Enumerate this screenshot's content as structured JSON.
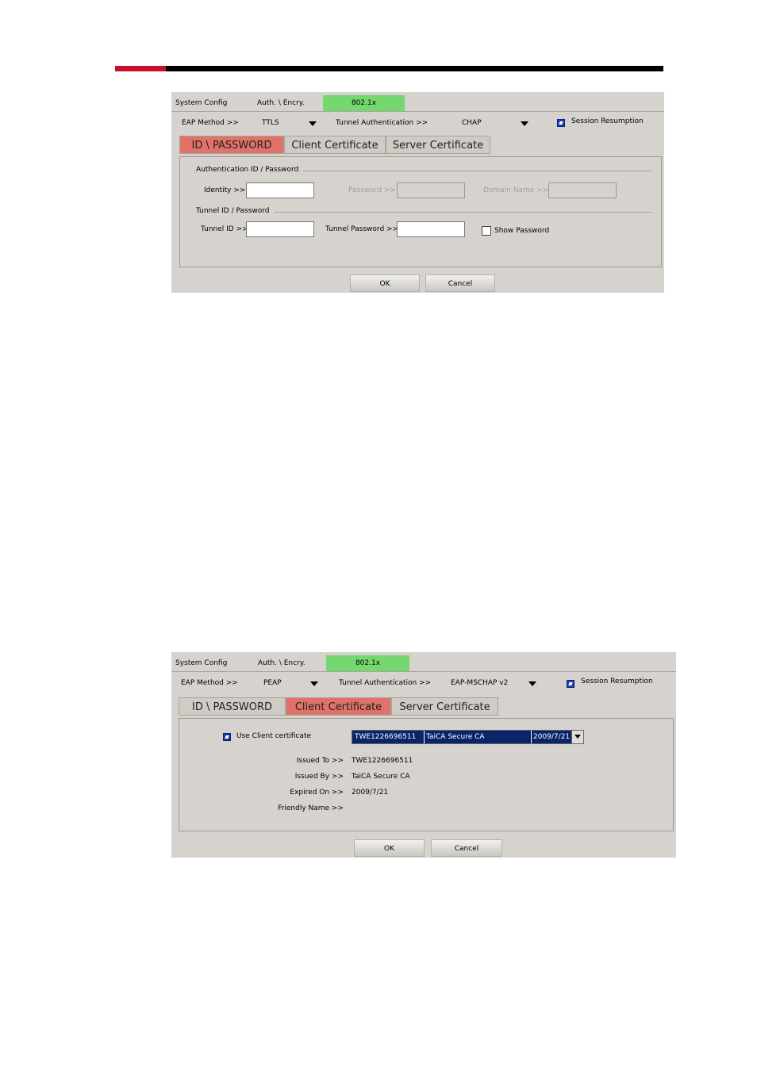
{
  "screen1": {
    "tabs": [
      "System Config",
      "Auth. \\ Encry.",
      "802.1x"
    ],
    "eap_method_label": "EAP Method >>",
    "eap_method_value": "TTLS",
    "tunnel_auth_label": "Tunnel Authentication >>",
    "tunnel_auth_value": "CHAP",
    "session_resumption": "Session Resumption",
    "session_resumption_checked": true,
    "subtabs": [
      "ID \\ PASSWORD",
      "Client Certificate",
      "Server Certificate"
    ],
    "active_subtab": "ID \\ PASSWORD",
    "auth_group": "Authentication ID / Password",
    "identity_label": "Identity >>",
    "password_label": "Password >>",
    "domain_label": "Domain Name >>",
    "tunnel_group": "Tunnel ID / Password",
    "tunnel_id_label": "Tunnel ID >>",
    "tunnel_password_label": "Tunnel Password >>",
    "show_password": "Show Password",
    "show_password_checked": false,
    "ok": "OK",
    "cancel": "Cancel"
  },
  "screen2": {
    "tabs": [
      "System Config",
      "Auth. \\ Encry.",
      "802.1x"
    ],
    "eap_method_label": "EAP Method >>",
    "eap_method_value": "PEAP",
    "tunnel_auth_label": "Tunnel Authentication >>",
    "tunnel_auth_value": "EAP-MSCHAP v2",
    "session_resumption": "Session Resumption",
    "session_resumption_checked": true,
    "subtabs": [
      "ID \\ PASSWORD",
      "Client Certificate",
      "Server Certificate"
    ],
    "active_subtab": "Client Certificate",
    "use_client_cert": "Use Client certificate",
    "use_client_cert_checked": true,
    "cert_select": {
      "issued_to": "TWE1226696511",
      "issued_by": "TaiCA Secure CA",
      "expired": "2009/7/21"
    },
    "issued_to_label": "Issued To >>",
    "issued_to_value": "TWE1226696511",
    "issued_by_label": "Issued By >>",
    "issued_by_value": "TaiCA Secure CA",
    "expired_on_label": "Expired On >>",
    "expired_on_value": "2009/7/21",
    "friendly_name_label": "Friendly Name >>",
    "friendly_name_value": "",
    "ok": "OK",
    "cancel": "Cancel"
  },
  "colors": {
    "accent_red": "#c8102e",
    "active_tab_green": "#75d86f",
    "active_subtab_red": "#e0726a",
    "panel_gray": "#d6d3ce"
  }
}
